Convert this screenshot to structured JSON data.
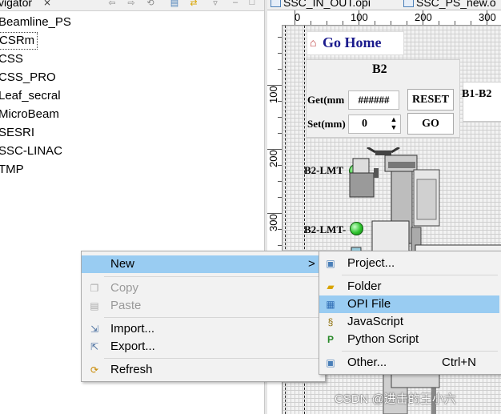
{
  "navigator": {
    "title": "vigator",
    "close_glyph": "⨯",
    "items": [
      "Beamline_PS",
      "CSRm",
      "CSS",
      "CSS_PRO",
      "Leaf_secral",
      "MicroBeam",
      "SESRI",
      "SSC-LINAC",
      "TMP"
    ],
    "selected_index": 1
  },
  "editor": {
    "tabs": [
      "SSC_IN_OUT.opi",
      "SSC_PS_new.o"
    ],
    "ruler_top": [
      "0",
      "100",
      "200",
      "300"
    ],
    "ruler_left": [
      "100",
      "200",
      "300"
    ],
    "go_home_label": "Go Home",
    "panel": {
      "title": "B2",
      "get_label": "Get(mm",
      "get_value": "######",
      "set_label": "Set(mm)",
      "set_value": "0",
      "reset_label": "RESET",
      "go_label": "GO",
      "b1b2_label": "B1-B2"
    },
    "limits": [
      "B2-LMT",
      "B2-LMT-"
    ],
    "led_color": "#2ec42e"
  },
  "context_menu": {
    "items": [
      {
        "label": "New",
        "icon": "new-icon",
        "has_submenu": true,
        "highlighted": true,
        "disabled": false
      },
      {
        "label": "Copy",
        "icon": "copy-icon",
        "disabled": true
      },
      {
        "label": "Paste",
        "icon": "paste-icon",
        "disabled": true
      },
      {
        "label": "Import...",
        "icon": "import-icon",
        "disabled": false
      },
      {
        "label": "Export...",
        "icon": "export-icon",
        "disabled": false
      },
      {
        "label": "Refresh",
        "icon": "refresh-icon",
        "disabled": false
      }
    ],
    "submenu_arrow": ">"
  },
  "submenu": {
    "items": [
      {
        "label": "Project...",
        "icon": "project-icon"
      },
      {
        "label": "Folder",
        "icon": "folder-icon"
      },
      {
        "label": "OPI File",
        "icon": "opi-file-icon",
        "highlighted": true
      },
      {
        "label": "JavaScript",
        "icon": "javascript-icon"
      },
      {
        "label": "Python Script",
        "icon": "python-script-icon"
      },
      {
        "label": "Other...",
        "icon": "other-icon",
        "shortcut": "Ctrl+N"
      }
    ]
  },
  "colors": {
    "menu_highlight": "#99ccf2",
    "go_home_text": "#1a1a8c"
  },
  "watermark": "CSDN @进击的王小六"
}
